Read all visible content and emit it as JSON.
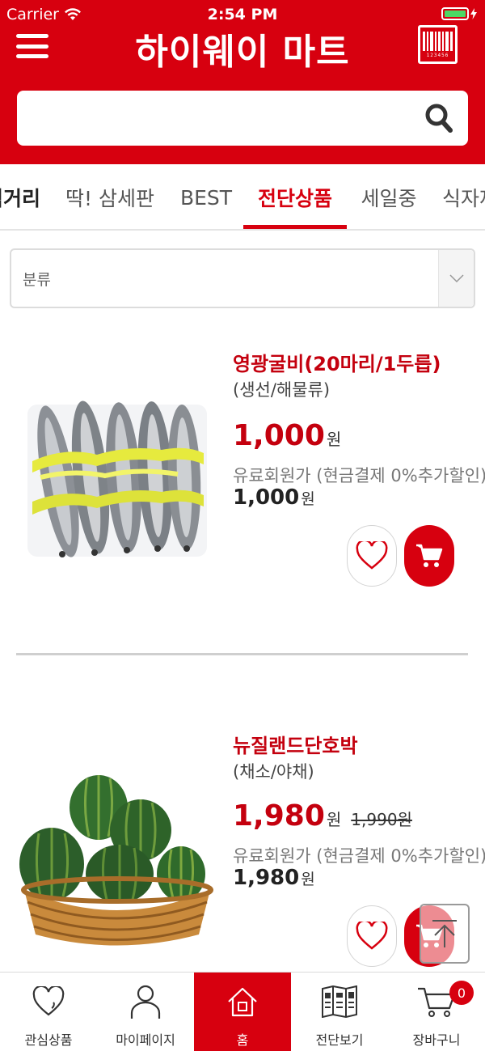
{
  "status_bar": {
    "carrier": "Carrier",
    "time": "2:54 PM"
  },
  "header": {
    "title": "하이웨이 마트",
    "barcode_digits": "123456",
    "search": {
      "value": "",
      "placeholder": ""
    }
  },
  "tabs": [
    {
      "label": "먹거리"
    },
    {
      "label": "딱! 삼세판"
    },
    {
      "label": "BEST"
    },
    {
      "label": "전단상품",
      "active": true
    },
    {
      "label": "세일중"
    },
    {
      "label": "식자재"
    }
  ],
  "category_select": {
    "value": "분류"
  },
  "products": [
    {
      "name": "영광굴비(20마리/1두릅)",
      "category": "(생선/해물류)",
      "price": "1,000",
      "currency": "원",
      "original_price": "",
      "member_label": "유료회원가 (현금결제 0%추가할인)",
      "member_price": "1,000",
      "member_currency": "원",
      "image": "dried-yellow-croaker-bundle"
    },
    {
      "name": "뉴질랜드단호박",
      "category": "(채소/야채)",
      "price": "1,980",
      "currency": "원",
      "original_price": "1,990원",
      "member_label": "유료회원가 (현금결제 0%추가할인)",
      "member_price": "1,980",
      "member_currency": "원",
      "image": "kabocha-squash-basket"
    }
  ],
  "bottom_nav": [
    {
      "label": "관심상품",
      "icon": "heart-icon"
    },
    {
      "label": "마이페이지",
      "icon": "person-icon"
    },
    {
      "label": "홈",
      "icon": "home-icon",
      "active": true
    },
    {
      "label": "전단보기",
      "icon": "flyer-icon"
    },
    {
      "label": "장바구니",
      "icon": "cart-icon"
    }
  ],
  "cart_badge": "0",
  "colors": {
    "brand_red": "#d7000f",
    "price_red": "#c4000e",
    "pumpkin_green": "#2f6b2a",
    "basket": "#c98a3c"
  }
}
